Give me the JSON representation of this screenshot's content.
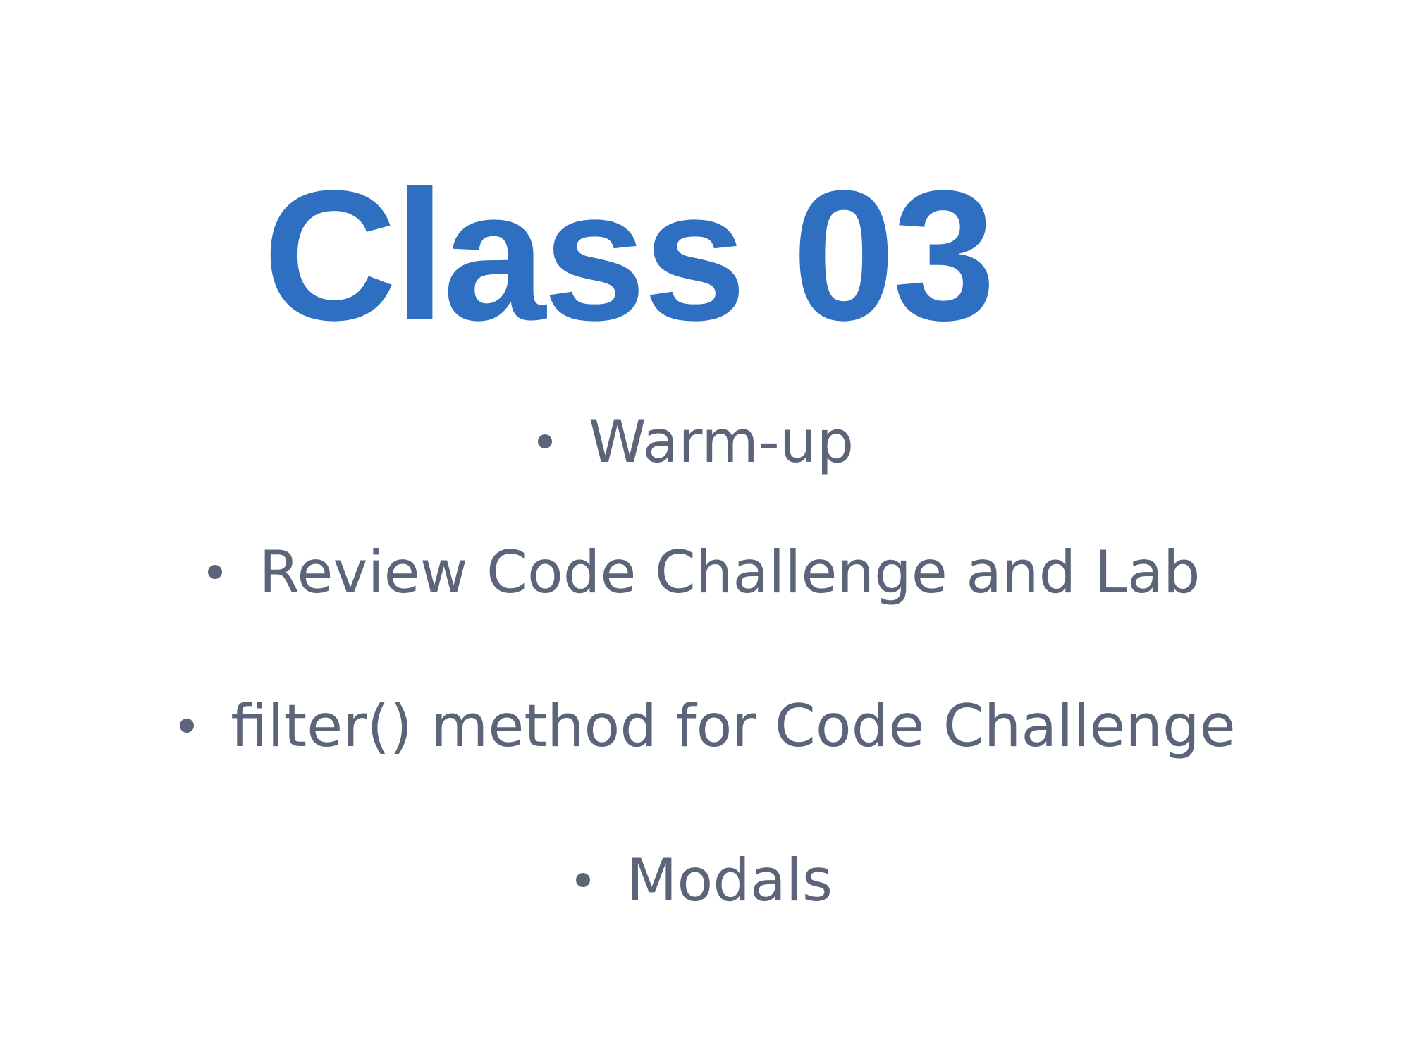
{
  "slide": {
    "title": "Class 03",
    "agenda": [
      "Warm-up",
      "Review Code Challenge and Lab",
      "filter() method for Code Challenge",
      "Modals"
    ]
  },
  "colors": {
    "title": "#2f6fc1",
    "body_text": "#5b6478",
    "background": "#ffffff"
  },
  "icons": {
    "bullet": "bullet-dot-icon"
  }
}
